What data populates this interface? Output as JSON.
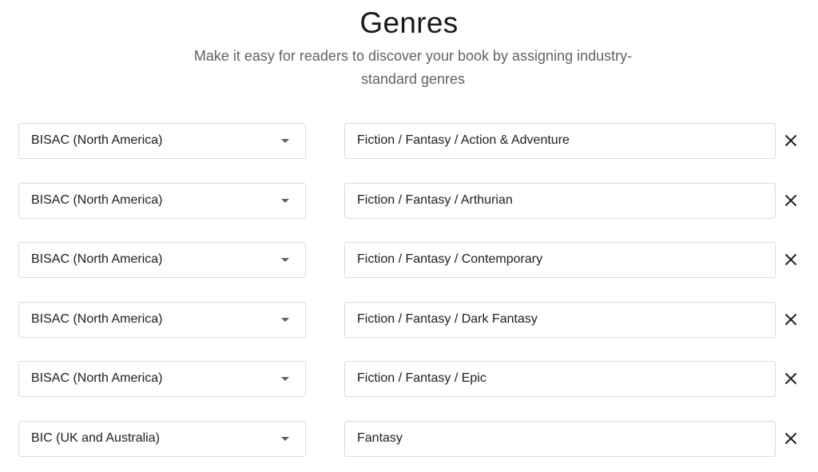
{
  "header": {
    "title": "Genres",
    "subtitle_line1": "Make it easy for readers to discover your book by assigning industry-",
    "subtitle_line2": "standard genres"
  },
  "genres": [
    {
      "scheme": "BISAC (North America)",
      "genre": "Fiction / Fantasy / Action & Adventure",
      "remove_icon": "close-icon"
    },
    {
      "scheme": "BISAC (North America)",
      "genre": "Fiction / Fantasy / Arthurian",
      "remove_icon": "close-icon"
    },
    {
      "scheme": "BISAC (North America)",
      "genre": "Fiction / Fantasy / Contemporary",
      "remove_icon": "close-icon"
    },
    {
      "scheme": "BISAC (North America)",
      "genre": "Fiction / Fantasy / Dark Fantasy",
      "remove_icon": "close-icon"
    },
    {
      "scheme": "BISAC (North America)",
      "genre": "Fiction / Fantasy / Epic",
      "remove_icon": "close-icon"
    },
    {
      "scheme": "BIC (UK and Australia)",
      "genre": "Fantasy",
      "remove_icon": "close-icon"
    }
  ],
  "colors": {
    "text": "#202124",
    "subtitle": "#5f6368",
    "border": "#dadce0"
  }
}
